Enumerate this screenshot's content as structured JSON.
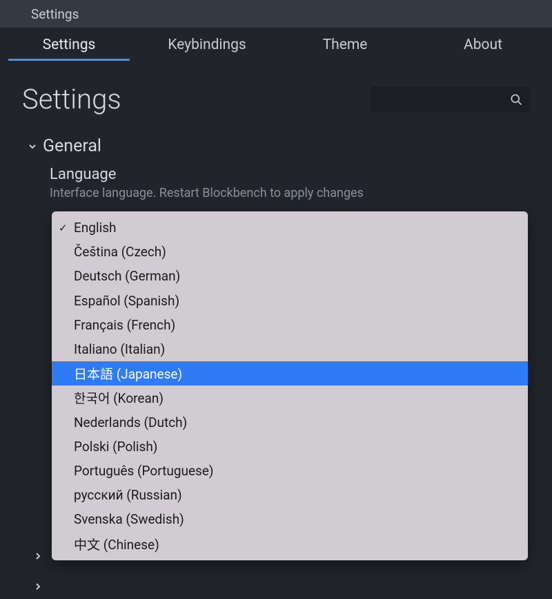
{
  "titlebar": {
    "title": "Settings"
  },
  "tabs": [
    {
      "label": "Settings",
      "active": true
    },
    {
      "label": "Keybindings",
      "active": false
    },
    {
      "label": "Theme",
      "active": false
    },
    {
      "label": "About",
      "active": false
    }
  ],
  "page": {
    "title": "Settings",
    "search_placeholder": ""
  },
  "section": {
    "general": {
      "title": "General",
      "expanded": true,
      "settings": {
        "language": {
          "label": "Language",
          "description": "Interface language. Restart Blockbench to apply changes"
        }
      }
    }
  },
  "dropdown": {
    "selected_index": 0,
    "highlighted_index": 6,
    "options": [
      "English",
      "Čeština (Czech)",
      "Deutsch (German)",
      "Español (Spanish)",
      "Français (French)",
      "Italiano (Italian)",
      "日本語 (Japanese)",
      "한국어 (Korean)",
      "Nederlands (Dutch)",
      "Polski (Polish)",
      "Português (Portuguese)",
      "русский (Russian)",
      "Svenska (Swedish)",
      "中文 (Chinese)"
    ]
  }
}
